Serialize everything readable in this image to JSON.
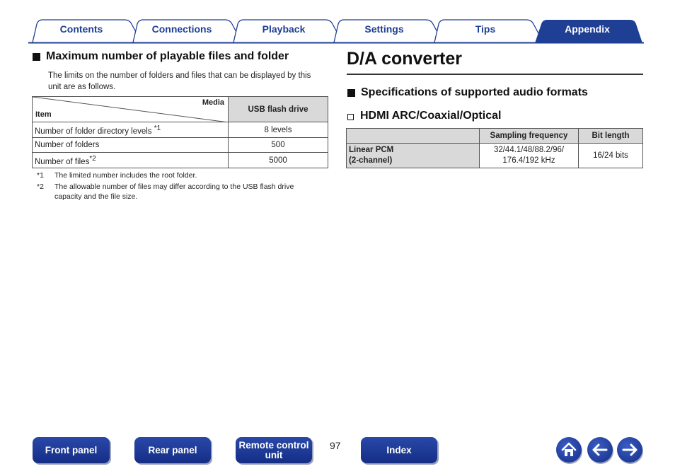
{
  "tabs": [
    {
      "label": "Contents",
      "active": false
    },
    {
      "label": "Connections",
      "active": false
    },
    {
      "label": "Playback",
      "active": false
    },
    {
      "label": "Settings",
      "active": false
    },
    {
      "label": "Tips",
      "active": false
    },
    {
      "label": "Appendix",
      "active": true
    }
  ],
  "left": {
    "heading": "Maximum number of playable files and folder",
    "intro": "The limits on the number of folders and files that can be displayed by this unit are as follows.",
    "table": {
      "corner_top": "Media",
      "corner_bottom": "Item",
      "column_header": "USB flash drive",
      "rows": [
        {
          "item": "Number of folder directory levels ",
          "mark": "*1",
          "value": "8 levels"
        },
        {
          "item": "Number of folders",
          "mark": "",
          "value": "500"
        },
        {
          "item": "Number of files",
          "mark": "*2",
          "value": "5000"
        }
      ]
    },
    "footnotes": [
      {
        "mark": "*1",
        "text": "The limited number includes the root folder."
      },
      {
        "mark": "*2",
        "text": "The allowable number of files may differ according to the USB flash drive capacity and the file size."
      }
    ]
  },
  "right": {
    "title": "D/A converter",
    "section_heading": "Specifications of supported audio formats",
    "sub_heading": "HDMI ARC/Coaxial/Optical",
    "table": {
      "headers": [
        "",
        "Sampling frequency",
        "Bit length"
      ],
      "rows": [
        {
          "format_line1": "Linear PCM",
          "format_line2": "(2-channel)",
          "sampling_line1": "32/44.1/48/88.2/96/",
          "sampling_line2": "176.4/192 kHz",
          "bits": "16/24 bits"
        }
      ]
    }
  },
  "bottom_nav": {
    "front_panel": "Front panel",
    "rear_panel": "Rear panel",
    "remote_line1": "Remote control",
    "remote_line2": "unit",
    "index": "Index",
    "page_number": "97"
  },
  "icons": {
    "home": "home-icon",
    "back": "arrow-left-icon",
    "forward": "arrow-right-icon"
  },
  "colors": {
    "tab_active": "#1f3f95",
    "tab_text": "#1f3f95",
    "nav_button": "#1f3a9a",
    "header_fill": "#d9d9d9"
  }
}
